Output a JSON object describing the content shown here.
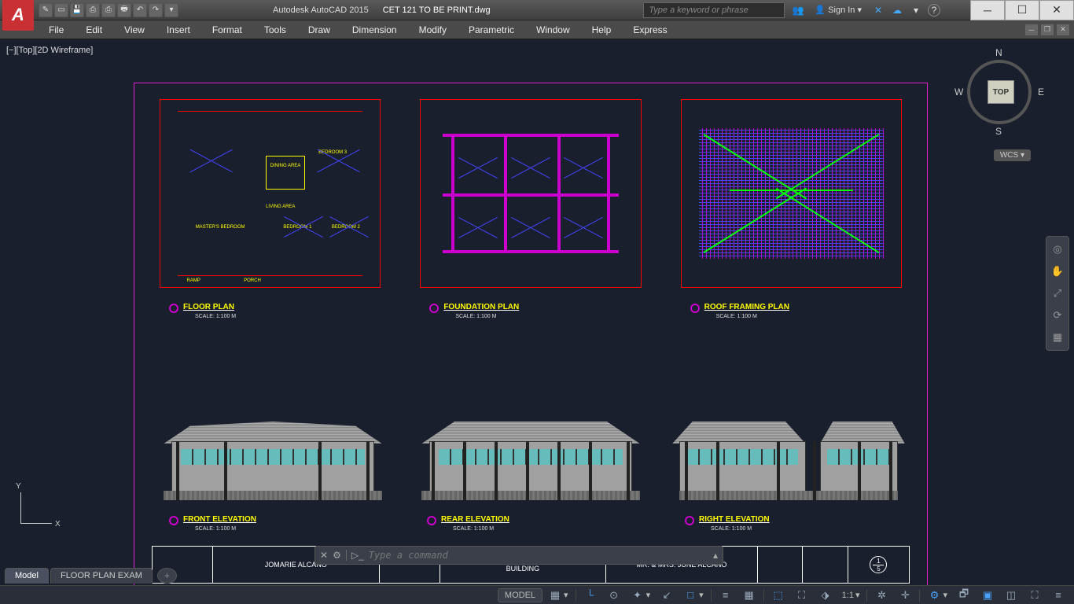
{
  "titlebar": {
    "app": "Autodesk AutoCAD 2015",
    "doc": "CET 121 TO BE PRINT.dwg",
    "search_ph": "Type a keyword or phrase",
    "signin": "Sign In"
  },
  "menubar": [
    "File",
    "Edit",
    "View",
    "Insert",
    "Format",
    "Tools",
    "Draw",
    "Dimension",
    "Modify",
    "Parametric",
    "Window",
    "Help",
    "Express"
  ],
  "viewport": {
    "label": "[−][Top][2D Wireframe]",
    "viewcube_face": "TOP",
    "wcs": "WCS",
    "compass": {
      "n": "N",
      "s": "S",
      "e": "E",
      "w": "W"
    },
    "ucs": {
      "x": "X",
      "y": "Y"
    }
  },
  "plans": [
    {
      "title": "FLOOR PLAN",
      "scale": "SCALE:                      1:100 M"
    },
    {
      "title": "FOUNDATION PLAN",
      "scale": "SCALE:                      1:100 M"
    },
    {
      "title": "ROOF FRAMING PLAN",
      "scale": "SCALE:                      1:100 M"
    }
  ],
  "elevations": [
    {
      "title": "FRONT ELEVATION",
      "scale": "SCALE:                      1:100 M"
    },
    {
      "title": "REAR ELEVATION",
      "scale": "SCALE:                      1:100 M"
    },
    {
      "title": "RIGHT ELEVATION",
      "scale": "SCALE:                      1:100 M"
    }
  ],
  "rooms": {
    "dining": "DINING AREA",
    "living": "LIVING AREA",
    "master": "MASTER'S BEDROOM",
    "bed1": "BEDROOM 1",
    "bed2": "BEDROOM 2",
    "bed3": "BEDROOM 3",
    "ramp": "RAMP",
    "porch": "PORCH"
  },
  "titleblock": {
    "left": "JOMARIE ALCANO",
    "center": "PROPOSED ONE -STOREY RESIDENTIAL BUILDING",
    "right": "MR. & MRS. JUNE ALCANO",
    "sheet_top": "1",
    "sheet_bot": "5"
  },
  "cmdline": {
    "placeholder": "Type a command"
  },
  "tabs": {
    "model": "Model",
    "layout": "FLOOR PLAN EXAM",
    "add": "+"
  },
  "statusbar": {
    "model": "MODEL",
    "scale": "1:1"
  }
}
